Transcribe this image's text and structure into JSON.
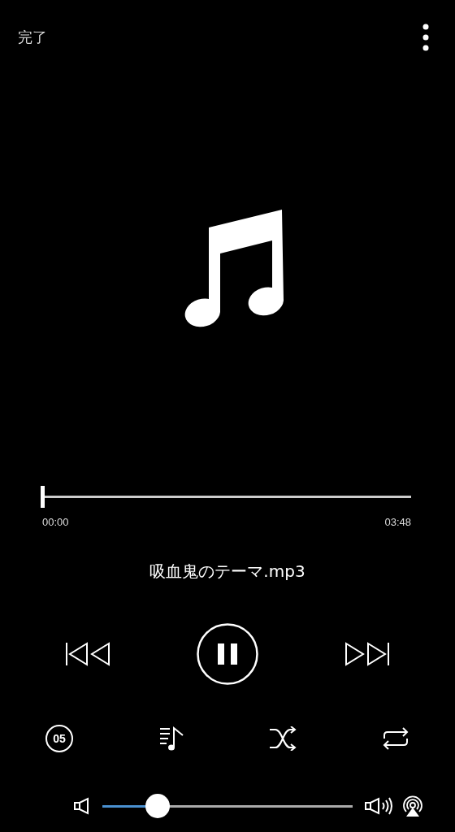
{
  "header": {
    "done": "完了"
  },
  "progress": {
    "level": 0.0,
    "elapsed": "00:00",
    "total": "03:48"
  },
  "track": {
    "title": "吸血鬼のテーマ.mp3"
  },
  "sleep_timer": {
    "minutes": "05"
  },
  "volume": {
    "level": 0.22
  }
}
